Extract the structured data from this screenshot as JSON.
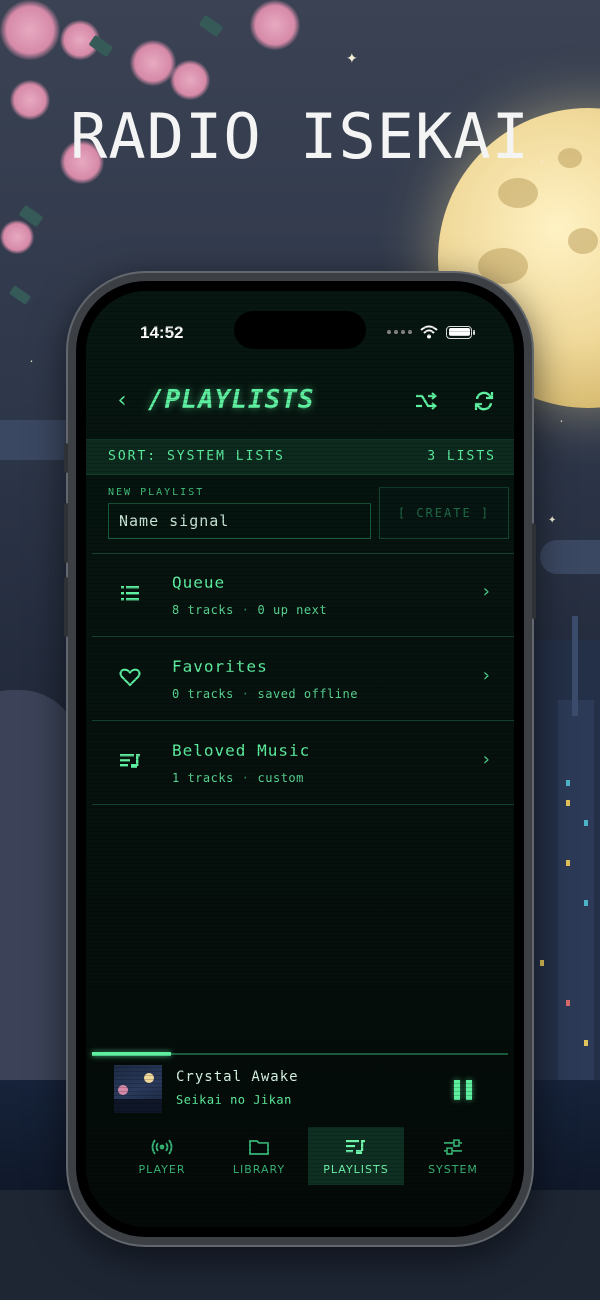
{
  "poster": {
    "title": "RADIO ISEKAI"
  },
  "status_bar": {
    "time": "14:52"
  },
  "header": {
    "title": "/PLAYLISTS"
  },
  "sort_bar": {
    "sort_label": "SORT: SYSTEM LISTS",
    "count_label": "3 LISTS"
  },
  "new_playlist": {
    "label": "NEW PLAYLIST",
    "placeholder": "Name signal",
    "value": "",
    "create_label": "[ CREATE ]"
  },
  "playlists": [
    {
      "name": "Queue",
      "count": "8 tracks",
      "detail": "0 up next",
      "icon": "list-icon"
    },
    {
      "name": "Favorites",
      "count": "0 tracks",
      "detail": "saved offline",
      "icon": "heart-icon"
    },
    {
      "name": "Beloved Music",
      "count": "1 tracks",
      "detail": "custom",
      "icon": "playlist-icon"
    }
  ],
  "now_playing": {
    "track": "Crystal Awake",
    "artist": "Seikai no Jikan",
    "progress": 0.19,
    "state": "playing"
  },
  "tabs": [
    {
      "label": "PLAYER",
      "icon": "broadcast-icon",
      "active": false
    },
    {
      "label": "LIBRARY",
      "icon": "folder-icon",
      "active": false
    },
    {
      "label": "PLAYLISTS",
      "icon": "playlist-icon",
      "active": true
    },
    {
      "label": "SYSTEM",
      "icon": "sliders-icon",
      "active": false
    }
  ],
  "colors": {
    "accent": "#5ef0a0",
    "background": "#06120e",
    "divider": "#12402c"
  }
}
